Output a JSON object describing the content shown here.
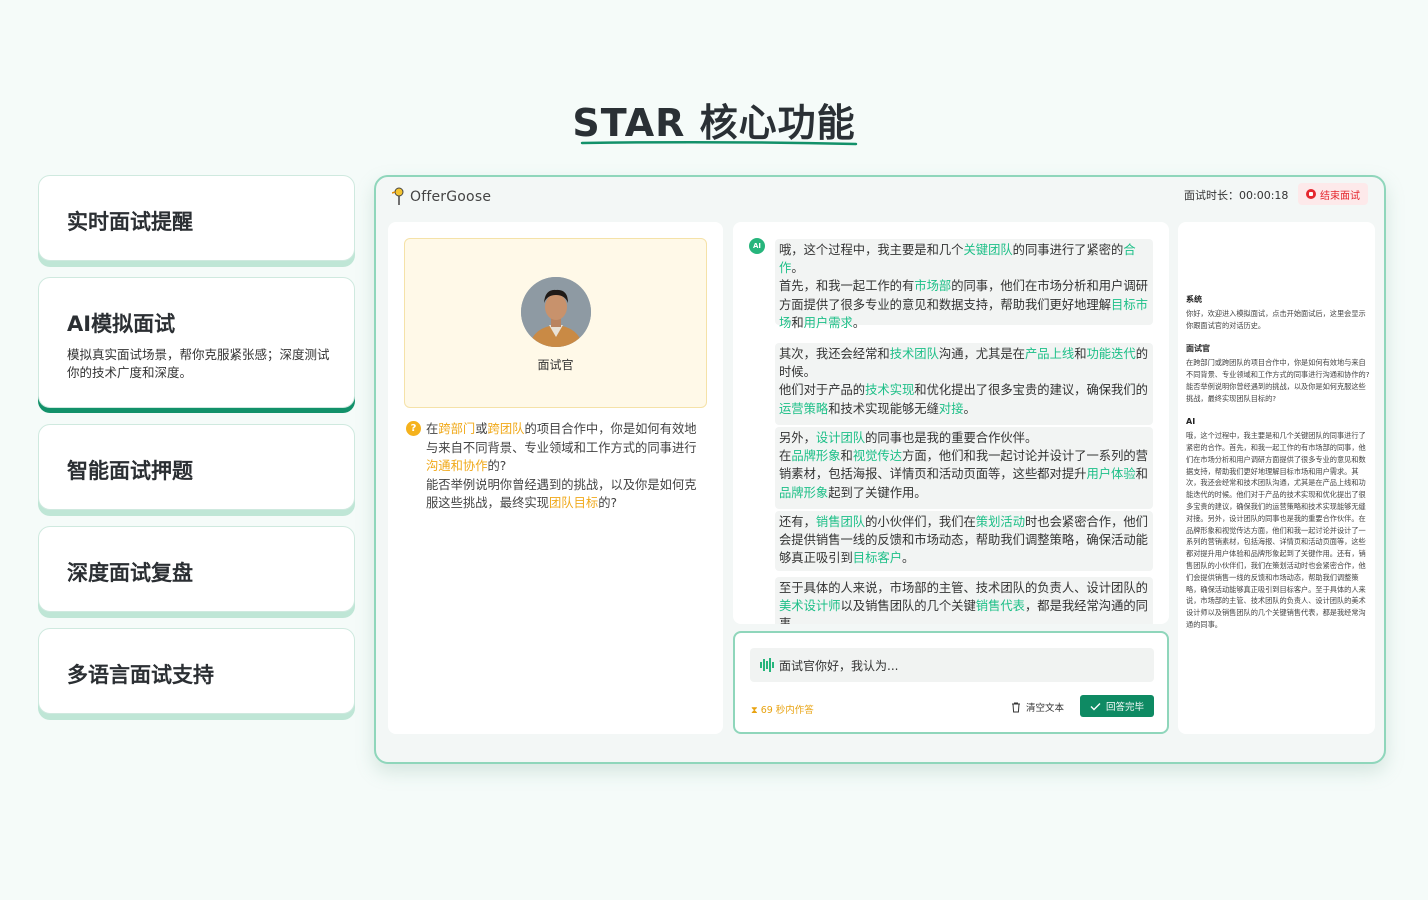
{
  "page": {
    "title": "STAR 核心功能",
    "accent": "#12916a"
  },
  "features": [
    {
      "title": "实时面试提醒"
    },
    {
      "title": "AI模拟面试",
      "description": "模拟真实面试场景，帮你克服紧张感；深度测试你的技术广度和深度。"
    },
    {
      "title": "智能面试押题"
    },
    {
      "title": "深度面试复盘"
    },
    {
      "title": "多语言面试支持"
    }
  ],
  "app": {
    "logo_text": "OfferGoose",
    "timer_label": "面试时长：00:00:18",
    "end_button": "结束面试",
    "interviewer_label": "面试官",
    "question_icon": "?",
    "question": [
      {
        "t": "在"
      },
      {
        "t": "跨部门",
        "c": "y"
      },
      {
        "t": "或"
      },
      {
        "t": "跨团队",
        "c": "y"
      },
      {
        "t": "的项目合作中，你是如何有效地与来自不同背景、专业领域和工作方式的同事进行"
      },
      {
        "t": "沟通和协作",
        "c": "y"
      },
      {
        "t": "的?"
      },
      {
        "br": true
      },
      {
        "t": "能否举例说明你曾经遇到的挑战，以及你是如何克服这些挑战，最终实现"
      },
      {
        "t": "团队目标",
        "c": "y"
      },
      {
        "t": "的?"
      }
    ],
    "ai_badge": "AI",
    "messages": [
      [
        {
          "t": "哦，这个过程中，我主要是和几个"
        },
        {
          "t": "关键团队",
          "c": "g"
        },
        {
          "t": "的同事进行了紧密的"
        },
        {
          "t": "合作",
          "c": "g"
        },
        {
          "t": "。"
        },
        {
          "br": true
        },
        {
          "t": "首先，和我一起工作的有"
        },
        {
          "t": "市场部",
          "c": "g"
        },
        {
          "t": "的同事，他们在市场分析和用户调研方面提供了很多专业的意见和数据支持，帮助我们更好地理解"
        },
        {
          "t": "目标市场",
          "c": "g"
        },
        {
          "t": "和"
        },
        {
          "t": "用户需求",
          "c": "g"
        },
        {
          "t": "。"
        }
      ],
      [
        {
          "t": "其次，我还会经常和"
        },
        {
          "t": "技术团队",
          "c": "g"
        },
        {
          "t": "沟通，尤其是在"
        },
        {
          "t": "产品上线",
          "c": "g"
        },
        {
          "t": "和"
        },
        {
          "t": "功能迭代",
          "c": "g"
        },
        {
          "t": "的时候。"
        },
        {
          "br": true
        },
        {
          "t": "他们对于产品的"
        },
        {
          "t": "技术实现",
          "c": "g"
        },
        {
          "t": "和优化提出了很多宝贵的建议，确保我们的"
        },
        {
          "t": "运营策略",
          "c": "g"
        },
        {
          "t": "和技术实现能够无缝"
        },
        {
          "t": "对接",
          "c": "g"
        },
        {
          "t": "。"
        }
      ],
      [
        {
          "t": "另外，"
        },
        {
          "t": "设计团队",
          "c": "g"
        },
        {
          "t": "的同事也是我的重要合作伙伴。"
        },
        {
          "br": true
        },
        {
          "t": "在"
        },
        {
          "t": "品牌形象",
          "c": "g"
        },
        {
          "t": "和"
        },
        {
          "t": "视觉传达",
          "c": "g"
        },
        {
          "t": "方面，他们和我一起讨论并设计了一系列的营销素材，包括海报、详情页和活动页面等，这些都对提升"
        },
        {
          "t": "用户体验",
          "c": "g"
        },
        {
          "t": "和"
        },
        {
          "t": "品牌形象",
          "c": "g"
        },
        {
          "t": "起到了关键作用。"
        }
      ],
      [
        {
          "t": "还有，"
        },
        {
          "t": "销售团队",
          "c": "g"
        },
        {
          "t": "的小伙伴们，我们在"
        },
        {
          "t": "策划活动",
          "c": "g"
        },
        {
          "t": "时也会紧密合作，他们会提供销售一线的反馈和市场动态，帮助我们调整策略，确保活动能够真正吸引到"
        },
        {
          "t": "目标客户",
          "c": "g"
        },
        {
          "t": "。"
        }
      ],
      [
        {
          "t": "至于具体的人来说，市场部的主管、技术团队的负责人、设计团队的"
        },
        {
          "t": "美术设计师",
          "c": "g"
        },
        {
          "t": "以及销售团队的几个关键"
        },
        {
          "t": "销售代表",
          "c": "g"
        },
        {
          "t": "，都是我经常沟通的同事。"
        }
      ]
    ],
    "input": {
      "value": "面试官你好，我认为..."
    },
    "countdown": "69 秒内作答",
    "clear_button": "清空文本",
    "done_button": "回答完毕",
    "transcript": [
      {
        "speaker": "系统",
        "text": "你好，欢迎进入模拟面试，点击开始面试后，这里会显示你跟面试官的对话历史。"
      },
      {
        "speaker": "面试官",
        "text": "在跨部门或跨团队的项目合作中，你是如何有效地与来自不同背景、专业领域和工作方式的同事进行沟通和协作的?能否举例说明你曾经遇到的挑战，以及你是如何克服这些挑战，最终实现团队目标的?"
      },
      {
        "speaker": "AI",
        "text": "哦，这个过程中，我主要是和几个关键团队的同事进行了紧密的合作。首先，和我一起工作的有市场部的同事，他们在市场分析和用户调研方面提供了很多专业的意见和数据支持，帮助我们更好地理解目标市场和用户需求。其次，我还会经常和技术团队沟通，尤其是在产品上线和功能迭代的时候。他们对于产品的技术实现和优化提出了很多宝贵的建议，确保我们的运营策略和技术实现能够无缝对接。另外，设计团队的同事也是我的重要合作伙伴。在品牌形象和视觉传达方面，他们和我一起讨论并设计了一系列的营销素材，包括海报、详情页和活动页面等，这些都对提升用户体验和品牌形象起到了关键作用。还有，销售团队的小伙伴们，我们在策划活动时也会紧密合作，他们会提供销售一线的反馈和市场动态，帮助我们调整策略，确保活动能够真正吸引到目标客户。至于具体的人来说，市场部的主管、技术团队的负责人、设计团队的美术设计师以及销售团队的几个关键销售代表，都是我经常沟通的同事。"
      }
    ]
  }
}
